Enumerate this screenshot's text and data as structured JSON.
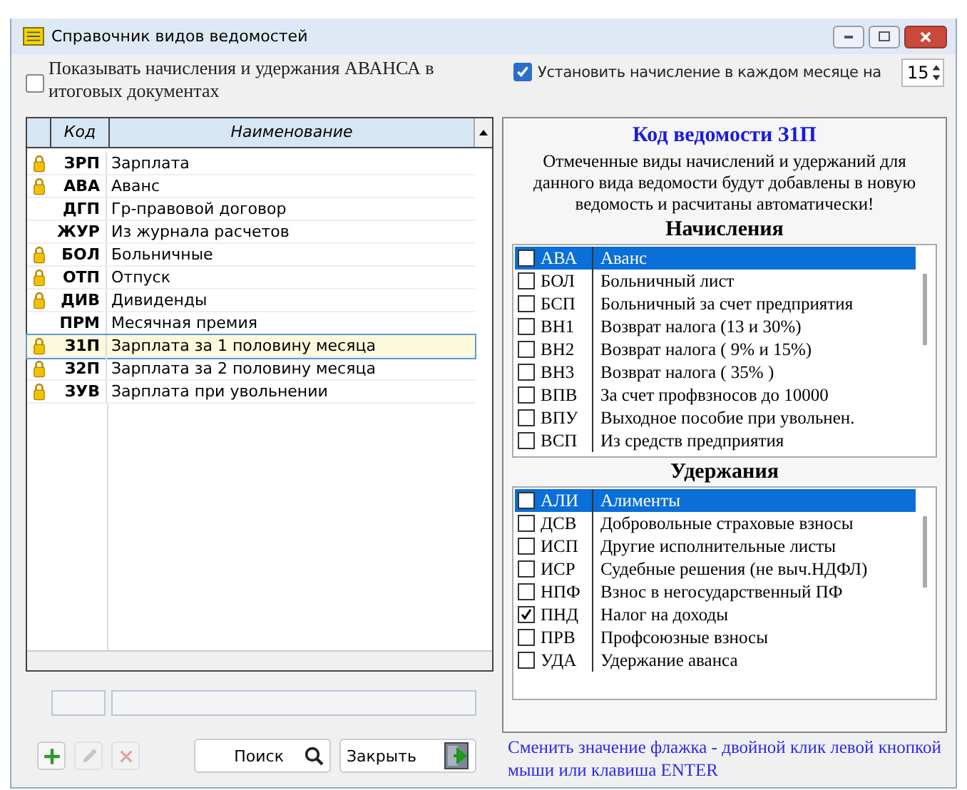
{
  "window": {
    "title": "Справочник видов ведомостей"
  },
  "show_advance": {
    "label": "Показывать начисления и удержания АВАНСА в итоговых документах",
    "checked": false
  },
  "set_monthly": {
    "label": "Установить начисление в каждом месяце на",
    "checked": true,
    "value": "15"
  },
  "table": {
    "columns": [
      "Код",
      "Наименование"
    ],
    "rows": [
      {
        "code": "ЗРП",
        "name": "Зарплата",
        "locked": true,
        "selected": false
      },
      {
        "code": "АВА",
        "name": "Аванс",
        "locked": true,
        "selected": false
      },
      {
        "code": "ДГП",
        "name": "Гр-правовой договор",
        "locked": false,
        "selected": false
      },
      {
        "code": "ЖУР",
        "name": "Из журнала расчетов",
        "locked": false,
        "selected": false
      },
      {
        "code": "БОЛ",
        "name": "Больничные",
        "locked": true,
        "selected": false
      },
      {
        "code": "ОТП",
        "name": "Отпуск",
        "locked": true,
        "selected": false
      },
      {
        "code": "ДИВ",
        "name": "Дивиденды",
        "locked": true,
        "selected": false
      },
      {
        "code": "ПРМ",
        "name": "Месячная премия",
        "locked": false,
        "selected": false
      },
      {
        "code": "З1П",
        "name": "Зарплата за 1 половину месяца",
        "locked": true,
        "selected": true
      },
      {
        "code": "З2П",
        "name": "Зарплата за 2 половину месяца",
        "locked": true,
        "selected": false
      },
      {
        "code": "ЗУВ",
        "name": "Зарплата при увольнении",
        "locked": true,
        "selected": false
      }
    ]
  },
  "detail": {
    "title": "Код ведомости З1П",
    "description": "Отмеченные виды начислений и удержаний для данного вида ведомости будут добавлены в новую ведомость и расчитаны автоматически!",
    "accruals": {
      "title": "Начисления",
      "items": [
        {
          "code": "АВА",
          "name": "Аванс",
          "checked": false,
          "selected": true
        },
        {
          "code": "БОЛ",
          "name": "Больничный лист",
          "checked": false,
          "selected": false
        },
        {
          "code": "БСП",
          "name": "Больничный за счет предприятия",
          "checked": false,
          "selected": false
        },
        {
          "code": "ВН1",
          "name": "Возврат налога (13 и 30%)",
          "checked": false,
          "selected": false
        },
        {
          "code": "ВН2",
          "name": "Возврат налога ( 9% и 15%)",
          "checked": false,
          "selected": false
        },
        {
          "code": "ВН3",
          "name": "Возврат налога ( 35% )",
          "checked": false,
          "selected": false
        },
        {
          "code": "ВПВ",
          "name": "За счет профвзносов до 10000",
          "checked": false,
          "selected": false
        },
        {
          "code": "ВПУ",
          "name": "Выходное пособие при увольнен.",
          "checked": false,
          "selected": false
        },
        {
          "code": "ВСП",
          "name": "Из средств предприятия",
          "checked": false,
          "selected": false
        }
      ]
    },
    "deductions": {
      "title": "Удержания",
      "items": [
        {
          "code": "АЛИ",
          "name": "Алименты",
          "checked": false,
          "selected": true
        },
        {
          "code": "ДСВ",
          "name": "Добровольные страховые взносы",
          "checked": false,
          "selected": false
        },
        {
          "code": "ИСП",
          "name": "Другие исполнительные листы",
          "checked": false,
          "selected": false
        },
        {
          "code": "ИСР",
          "name": "Судебные решения (не выч.НДФЛ)",
          "checked": false,
          "selected": false
        },
        {
          "code": "НПФ",
          "name": "Взнос в негосударственный ПФ",
          "checked": false,
          "selected": false
        },
        {
          "code": "ПНД",
          "name": "Налог на доходы",
          "checked": true,
          "selected": false
        },
        {
          "code": "ПРВ",
          "name": "Профсоюзные взносы",
          "checked": false,
          "selected": false
        },
        {
          "code": "УДА",
          "name": "Удержание аванса",
          "checked": false,
          "selected": false
        }
      ]
    }
  },
  "hint": "Сменить значение флажка - двойной клик левой кнопкой мыши или клавиша ENTER",
  "toolbar": {
    "add_disabled": false,
    "edit_disabled": true,
    "delete_disabled": true
  },
  "buttons": {
    "search": "Поиск",
    "close": "Закрыть"
  }
}
